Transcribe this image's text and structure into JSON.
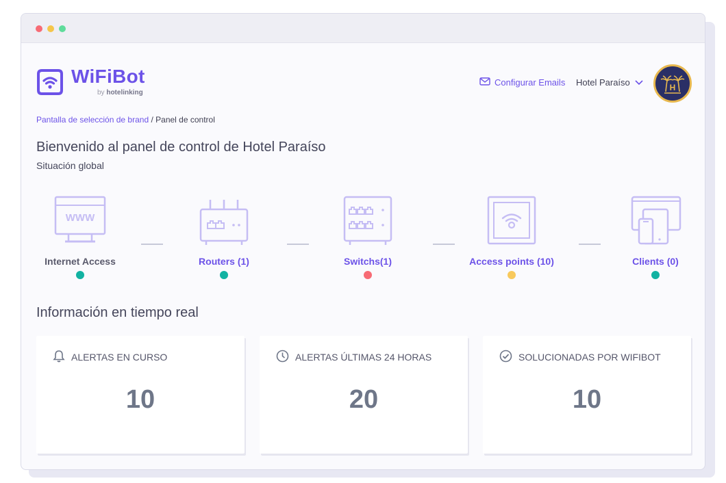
{
  "brand": {
    "name": "WiFiBot",
    "by_prefix": "by",
    "by_brand": "hotelinking",
    "accent": "#6c52e8"
  },
  "header": {
    "config_emails_label": "Configurar Emails",
    "config_emails_icon": "envelope-icon",
    "hotel_name": "Hotel Paraíso",
    "hotel_dropdown_icon": "chevron-down-icon",
    "avatar_text": "H"
  },
  "breadcrumb": {
    "parent": "Pantalla de selección de brand",
    "separator": "/",
    "current": "Panel de control"
  },
  "page": {
    "title": "Bienvenido al panel de control de Hotel Paraíso",
    "subtitle": "Situación global"
  },
  "topology": [
    {
      "label": "Internet Access",
      "icon": "browser-www-icon",
      "status_color": "#12b2a2",
      "link": false
    },
    {
      "label": "Routers (1)",
      "icon": "router-icon",
      "status_color": "#12b2a2",
      "link": true
    },
    {
      "label": "Switchs(1)",
      "icon": "switch-icon",
      "status_color": "#f76b75",
      "link": true
    },
    {
      "label": "Access points (10)",
      "icon": "access-point-icon",
      "status_color": "#f8c95c",
      "link": true
    },
    {
      "label": "Clients (0)",
      "icon": "devices-icon",
      "status_color": "#12b2a2",
      "link": true
    }
  ],
  "realtime": {
    "title": "Información en tiempo real",
    "cards": [
      {
        "label": "ALERTAS EN CURSO",
        "icon": "bell-icon",
        "value": "10"
      },
      {
        "label": "ALERTAS ÚLTIMAS 24 HORAS",
        "icon": "clock-icon",
        "value": "20"
      },
      {
        "label": "SOLUCIONADAS POR WIFIBOT",
        "icon": "check-circle-icon",
        "value": "10"
      }
    ]
  }
}
